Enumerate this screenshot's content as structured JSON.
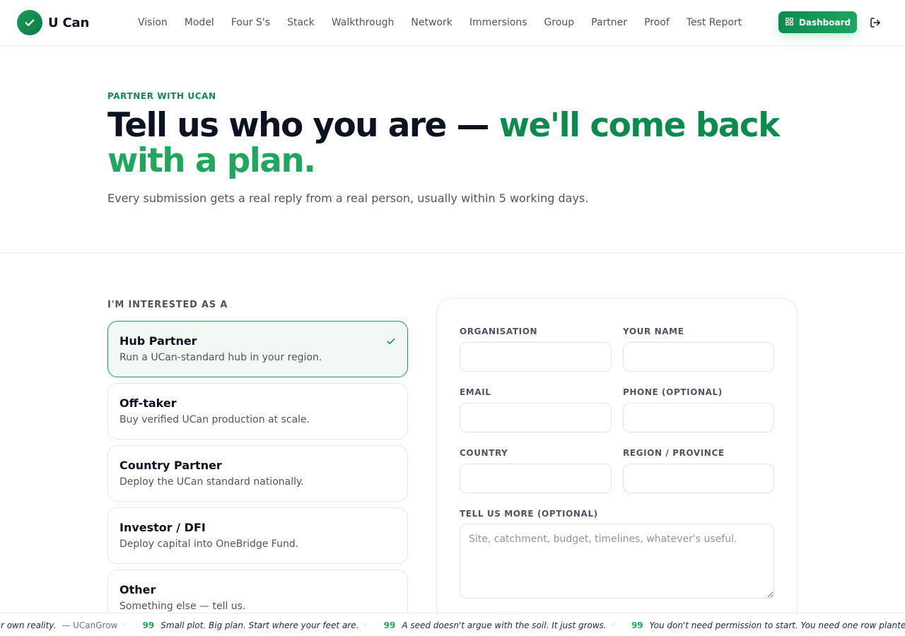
{
  "brand": {
    "name": "U Can"
  },
  "nav": [
    "Vision",
    "Model",
    "Four S's",
    "Stack",
    "Walkthrough",
    "Network",
    "Immersions",
    "Group",
    "Partner",
    "Proof",
    "Test Report"
  ],
  "header": {
    "dashboard_label": "Dashboard"
  },
  "hero": {
    "eyebrow": "PARTNER WITH UCAN",
    "headline_dark": "Tell us who you are — ",
    "headline_green": "we'll come back",
    "headline_green2": "with a plan.",
    "lead": "Every submission gets a real reply from a real person, usually within 5 working days."
  },
  "interest": {
    "label": "I'M INTERESTED AS A",
    "selected": "Hub Partner",
    "options": [
      {
        "title": "Hub Partner",
        "desc": "Run a UCan-standard hub in your region."
      },
      {
        "title": "Off-taker",
        "desc": "Buy verified UCan production at scale."
      },
      {
        "title": "Country Partner",
        "desc": "Deploy the UCan standard nationally."
      },
      {
        "title": "Investor / DFI",
        "desc": "Deploy capital into OneBridge Fund."
      },
      {
        "title": "Other",
        "desc": "Something else — tell us."
      }
    ]
  },
  "form": {
    "organisation_label": "ORGANISATION",
    "name_label": "YOUR NAME",
    "email_label": "EMAIL",
    "phone_label": "PHONE (OPTIONAL)",
    "country_label": "COUNTRY",
    "region_label": "REGION / PROVINCE",
    "more_label": "TELL US MORE (OPTIONAL)",
    "more_placeholder": "Site, catchment, budget, timelines, whatever's useful."
  },
  "ticker": {
    "quotes": [
      {
        "text": "our own reality.",
        "author": "— UCanGrow"
      },
      {
        "text": "Small plot. Big plan. Start where your feet are.",
        "author": ""
      },
      {
        "text": "A seed doesn't argue with the soil. It just grows.",
        "author": ""
      },
      {
        "text": "You don't need permission to start. You need one row planted.",
        "author": ""
      }
    ]
  },
  "colors": {
    "accent": "#0f8a4e",
    "accent_light": "#22a65d",
    "selected_bg": "#f2f9f5"
  }
}
